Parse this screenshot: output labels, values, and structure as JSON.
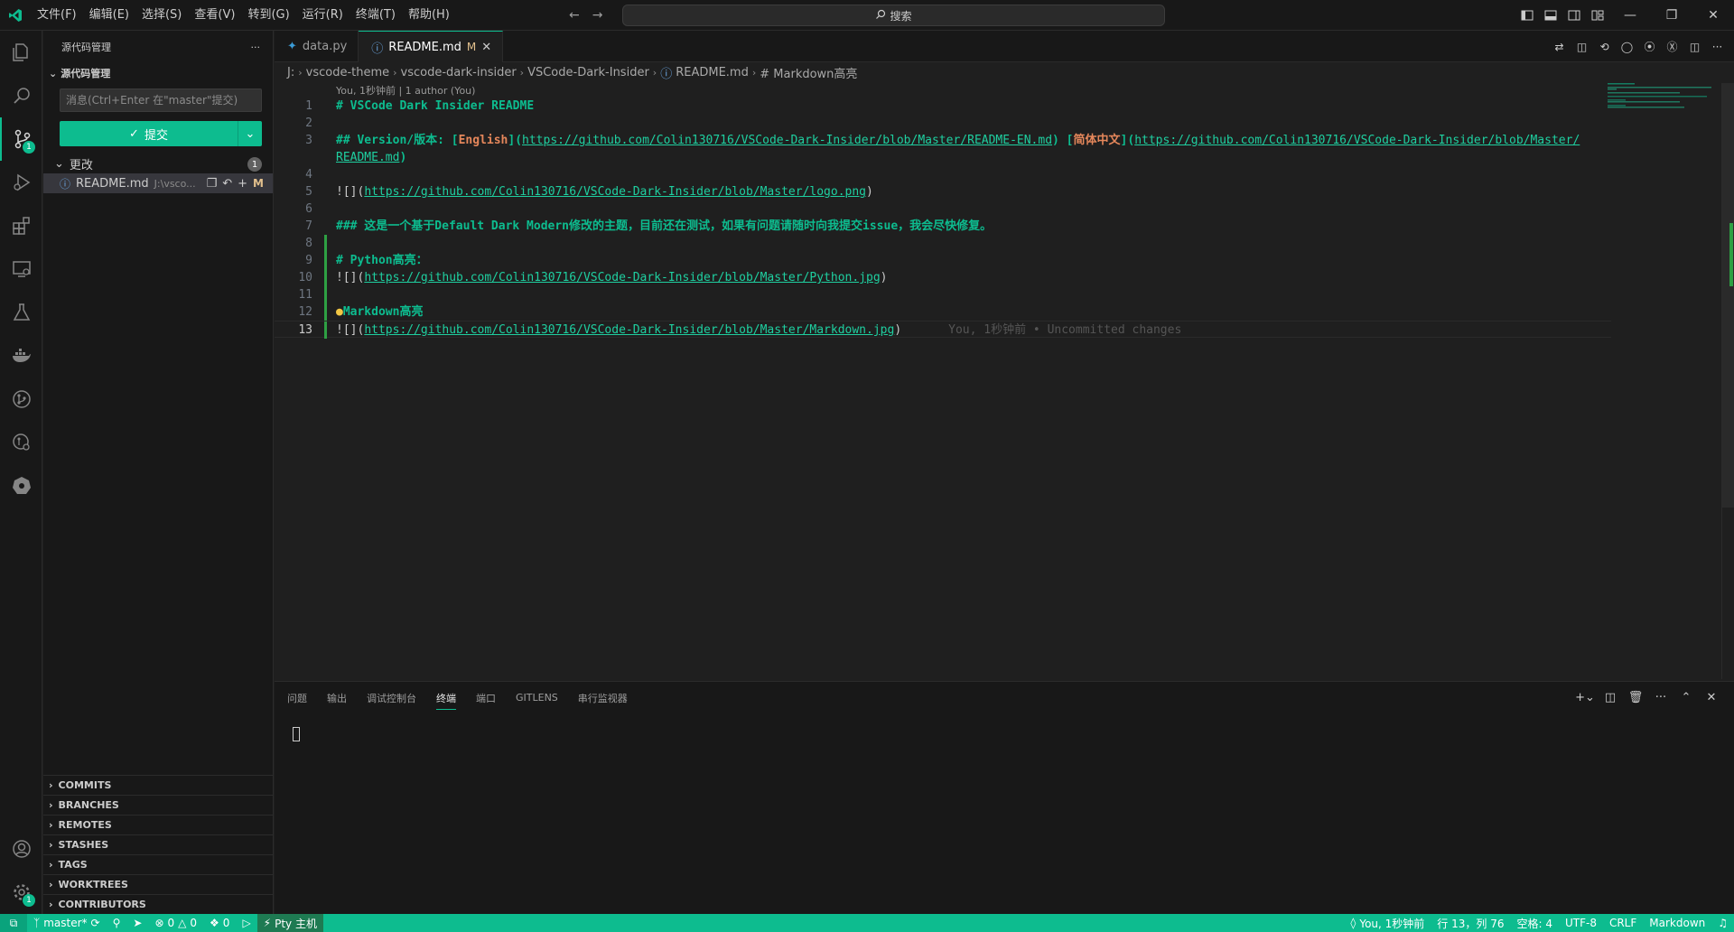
{
  "titlebar": {
    "menu": [
      "文件(F)",
      "编辑(E)",
      "选择(S)",
      "查看(V)",
      "转到(G)",
      "运行(R)",
      "终端(T)",
      "帮助(H)"
    ],
    "search_placeholder": "搜索"
  },
  "activity": {
    "scm_badge": "1",
    "settings_badge": "1"
  },
  "sidebar": {
    "header": "源代码管理",
    "section_title": "源代码管理",
    "commit_placeholder": "消息(Ctrl+Enter 在\"master\"提交)",
    "commit_label": "提交",
    "changes_label": "更改",
    "changes_count": "1",
    "change_file": "README.md",
    "change_path": "J:\\vsco...",
    "change_status": "M",
    "sections": [
      "COMMITS",
      "BRANCHES",
      "REMOTES",
      "STASHES",
      "TAGS",
      "WORKTREES",
      "CONTRIBUTORS"
    ]
  },
  "tabs": [
    {
      "label": "data.py",
      "modified": ""
    },
    {
      "label": "README.md",
      "modified": "M"
    }
  ],
  "breadcrumb": [
    "J:",
    "vscode-theme",
    "vscode-dark-insider",
    "VSCode-Dark-Insider",
    "README.md",
    "# Markdown高亮"
  ],
  "codelens": "You, 1秒钟前 | 1 author (You)",
  "code": {
    "l1": "# VSCode Dark Insider README",
    "l3_head": "## Version/版本: [",
    "l3_en": "English",
    "l3_mid1": "](",
    "l3_link1": "https://github.com/Colin130716/VSCode-Dark-Insider/blob/Master/README-EN.md",
    "l3_mid2": ") [",
    "l3_zh": "简体中文",
    "l3_mid3": "](",
    "l3_link2": "https://github.com/Colin130716/VSCode-Dark-Insider/blob/Master/",
    "l3_cont_link": "README.md",
    "l3_cont_end": ")",
    "l5_pre": "![](",
    "l5_link": "https://github.com/Colin130716/VSCode-Dark-Insider/blob/Master/logo.png",
    "l5_post": ")",
    "l7": "### 这是一个基于Default Dark Modern修改的主题，目前还在测试，如果有问题请随时向我提交issue，我会尽快修复。",
    "l9": "# Python高亮：",
    "l10_pre": "![](",
    "l10_link": "https://github.com/Colin130716/VSCode-Dark-Insider/blob/Master/Python.jpg",
    "l10_post": ")",
    "l12": "Markdown高亮",
    "l13_pre": "![](",
    "l13_link": "https://github.com/Colin130716/VSCode-Dark-Insider/blob/Master/Markdown.jpg",
    "l13_post": ")",
    "l13_ghost": "You, 1秒钟前 • Uncommitted changes",
    "line_numbers": [
      "1",
      "2",
      "3",
      "",
      "4",
      "5",
      "6",
      "7",
      "8",
      "9",
      "10",
      "11",
      "12",
      "13"
    ]
  },
  "panel": {
    "tabs": [
      "问题",
      "输出",
      "调试控制台",
      "终端",
      "端口",
      "GITLENS",
      "串行监视器"
    ]
  },
  "status": {
    "branch": "master*",
    "errors": "0",
    "warnings": "0",
    "ports": "0",
    "python": "Pty 主机",
    "blame": "You, 1秒钟前",
    "position": "行 13，列 76",
    "spaces": "空格: 4",
    "encoding": "UTF-8",
    "eol": "CRLF",
    "language": "Markdown"
  },
  "colors": {
    "accent": "#0dbc8f",
    "background": "#1f1f1f",
    "sidebar": "#181818"
  }
}
